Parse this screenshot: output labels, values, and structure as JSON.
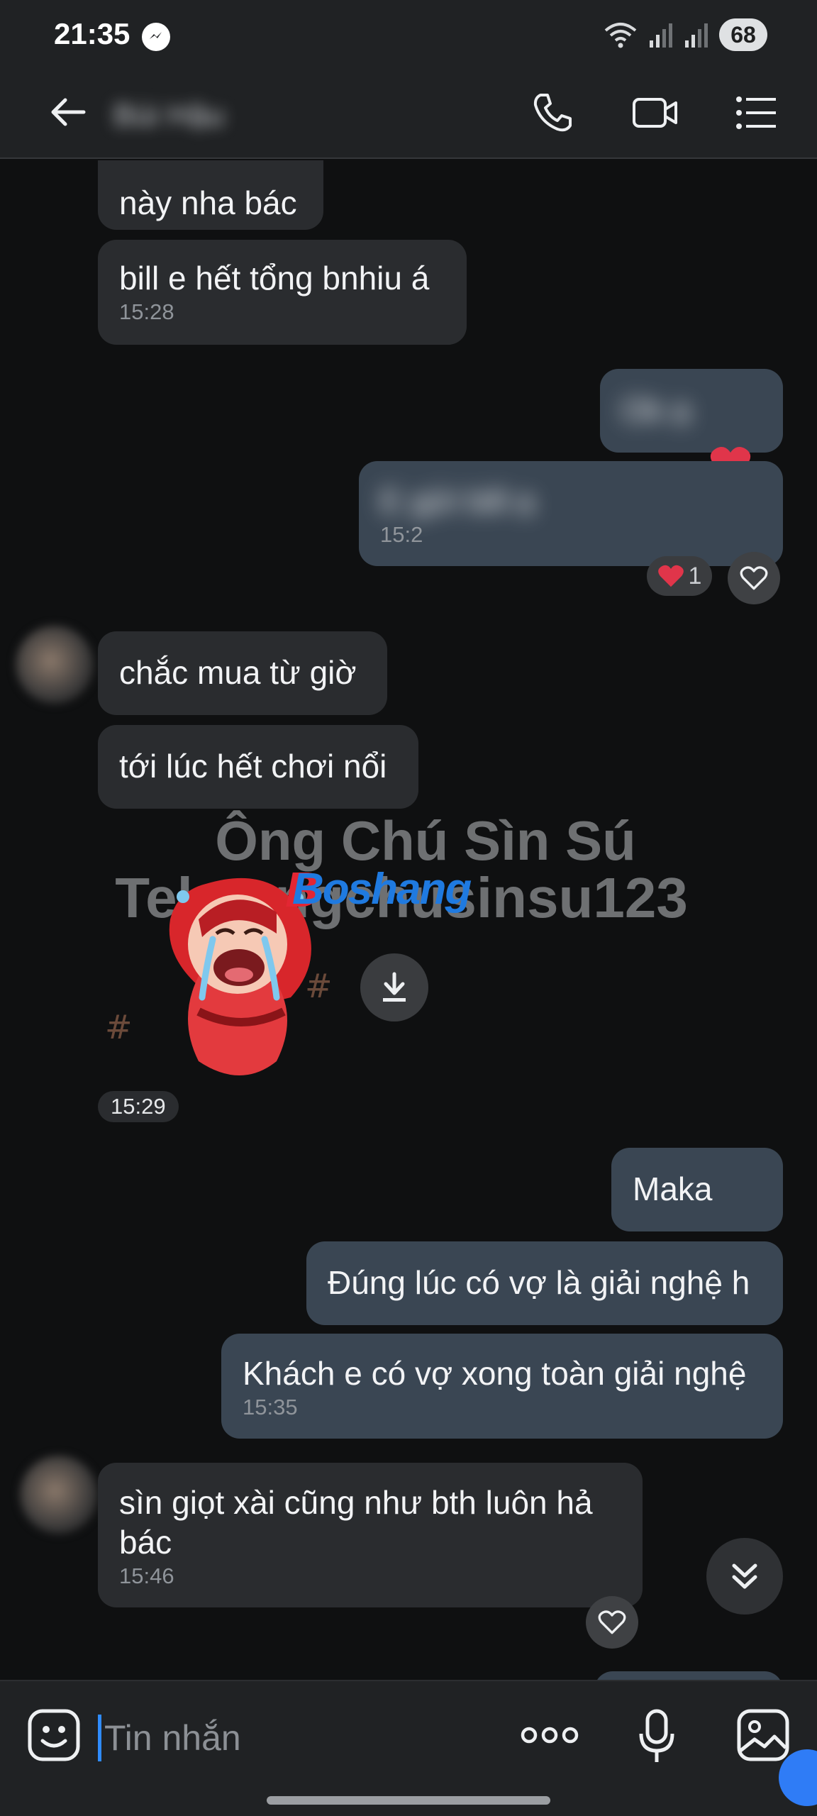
{
  "status_bar": {
    "time": "21:35",
    "battery": "68"
  },
  "header": {
    "contact_name": "Bùi Hậu",
    "icons": [
      "back-arrow-icon",
      "phone-icon",
      "video-call-icon",
      "menu-list-icon"
    ]
  },
  "messages": [
    {
      "dir": "in",
      "text": "này nha bác"
    },
    {
      "dir": "in",
      "text": "bill e hết tổng bnhiu á",
      "time": "15:28"
    },
    {
      "dir": "out",
      "text": "Ok ạ",
      "redacted": true
    },
    {
      "dir": "out",
      "text": "E gửi bill ạ",
      "time": "15:2",
      "redacted": true,
      "reaction_count": "1"
    },
    {
      "dir": "in",
      "text": "chắc mua từ giờ"
    },
    {
      "dir": "in",
      "text": "tới lúc hết chơi nổi"
    },
    {
      "dir": "in",
      "type": "sticker",
      "time": "15:29"
    },
    {
      "dir": "out",
      "text": "Maka"
    },
    {
      "dir": "out",
      "text": "Đúng lúc có vợ là giải nghệ h"
    },
    {
      "dir": "out",
      "text": "Khách e có vợ xong toàn giải nghệ",
      "time": "15:35"
    },
    {
      "dir": "in",
      "text": "sìn giọt xài cũng như bth luôn hả bác",
      "time": "15:46"
    }
  ],
  "watermark": {
    "line1": "Ông Chú Sìn Sú",
    "line2": "Tele ongchusinsu123",
    "logo": "Boshang"
  },
  "composer": {
    "placeholder": "Tin nhắn"
  },
  "colors": {
    "background": "#0f1011",
    "incoming_bubble": "#2a2c2f",
    "outgoing_bubble": "#3a4653",
    "accent": "#2f8cff",
    "reaction_heart": "#e0354a"
  }
}
